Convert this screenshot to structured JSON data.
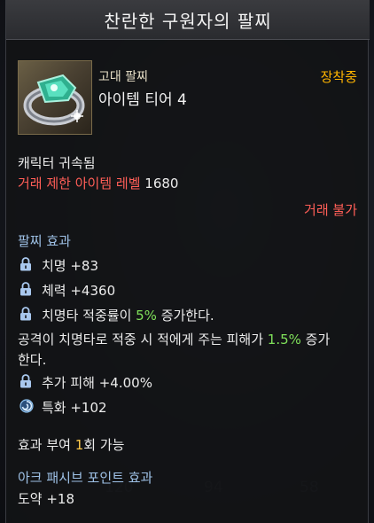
{
  "background": {
    "fragments": [
      "120",
      "94",
      "58"
    ]
  },
  "tooltip": {
    "title": "찬란한 구원자의 팔찌",
    "item": {
      "grade": "고대 팔찌",
      "tier": "아이템 티어 4",
      "equipped": "장착중"
    },
    "bound": "캐릭터 귀속됨",
    "trade_limit_label": "거래 제한 아이템 레벨",
    "trade_limit_value": "1680",
    "trade_status": "거래 불가",
    "effects_header": "팔찌 효과",
    "effects": [
      {
        "icon": "lock-icon",
        "text": "치명 +83"
      },
      {
        "icon": "lock-icon",
        "text": "체력 +4360"
      },
      {
        "icon": "lock-icon",
        "text_pre": "치명타 적중률이 ",
        "highlight": "5%",
        "text_post": " 증가한다."
      }
    ],
    "long_effect": {
      "line1_pre": "공격이 치명타로 적중 시 적에게 주는 피해가 ",
      "line1_highlight": "1.5%",
      "line1_post": " 증가",
      "line2": "한다."
    },
    "extra_effects": [
      {
        "icon": "lock-icon",
        "text": "추가 피해 +4.00%"
      },
      {
        "icon": "swirl-icon",
        "text": "특화 +102"
      }
    ],
    "grant": {
      "pre": "효과 부여 ",
      "count": "1",
      "post": "회 가능"
    },
    "ark_header": "아크 패시브 포인트 효과",
    "ark_value": "도약 +18"
  }
}
